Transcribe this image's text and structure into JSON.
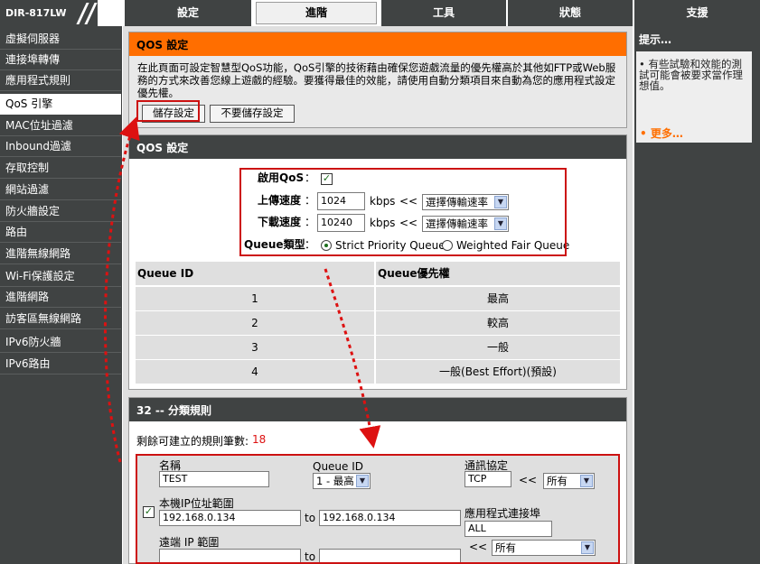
{
  "header": {
    "model": "DIR-817LW",
    "tabs": [
      "設定",
      "進階",
      "工具",
      "狀態",
      "支援"
    ],
    "active_tab": "進階"
  },
  "sidebar": {
    "items": [
      "虛擬伺服器",
      "連接埠轉傳",
      "應用程式規則",
      "QoS 引擎",
      "MAC位址過濾",
      "Inbound過濾",
      "存取控制",
      "網站過濾",
      "防火牆設定",
      "路由",
      "進階無線網路",
      "Wi-Fi保護設定",
      "進階網路",
      "訪客區無線網路",
      "IPv6防火牆",
      "IPv6路由"
    ],
    "active_item": "QoS 引擎"
  },
  "hints": {
    "title": "提示…",
    "bullet": "•",
    "text": "有些試驗和效能的測試可能會被要求當作理想值。",
    "more": "• 更多…"
  },
  "qos_intro": {
    "title": "QOS 設定",
    "description": "在此頁面可設定智慧型QoS功能，QoS引擎的技術藉由確保您遊戲流量的優先權高於其他如FTP或Web服務的方式來改善您線上遊戲的經驗。要獲得最佳的效能，請使用自動分類項目來自動為您的應用程式設定優先權。",
    "save_label": "儲存設定",
    "dont_save_label": "不要儲存設定"
  },
  "qos_settings": {
    "title": "QOS 設定",
    "enable_label": "啟用QoS",
    "colon": "：",
    "enabled": true,
    "upload_label": "上傳速度",
    "upload_value": "1024",
    "download_label": "下載速度",
    "download_value": "10240",
    "unit": "kbps",
    "arrows": "<<",
    "rate_select": "選擇傳輸速率",
    "queue_type_label": "Queue類型",
    "queue_type_options": [
      "Strict Priority Queue",
      "Weighted Fair Queue"
    ],
    "queue_type_selected": "Strict Priority Queue",
    "table_headers": [
      "Queue ID",
      "Queue優先權"
    ],
    "rows": [
      {
        "id": "1",
        "priority": "最高"
      },
      {
        "id": "2",
        "priority": "較高"
      },
      {
        "id": "3",
        "priority": "一般"
      },
      {
        "id": "4",
        "priority": "一般(Best Effort)(預設)"
      }
    ]
  },
  "rules": {
    "title": "32 -- 分類規則",
    "remaining_label": "剩餘可建立的規則筆數:",
    "remaining_value": "18",
    "name_label": "名稱",
    "name_value": "TEST",
    "queue_id_label": "Queue ID",
    "queue_id_value": "1 - 最高",
    "protocol_label": "通訊協定",
    "protocol_value": "TCP",
    "protocol_select": "所有",
    "local_ip_label": "本機IP位址範圍",
    "local_ip_from": "192.168.0.134",
    "local_ip_to": "192.168.0.134",
    "to_label": "to",
    "app_port_label": "應用程式連接埠",
    "app_port_value": "ALL",
    "app_port_select": "所有",
    "remote_ip_label": "遠端 IP 範圍",
    "remote_ip_from": "",
    "remote_ip_to": "",
    "rule_enabled": true
  },
  "colors": {
    "nav_bg": "#404343",
    "accent_orange": "#ff6e00",
    "annotation_red": "#cc1111",
    "remaining_red": "#dd1111"
  }
}
